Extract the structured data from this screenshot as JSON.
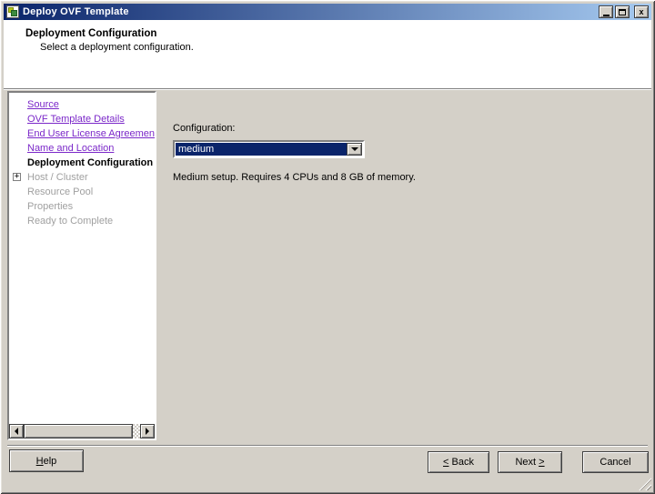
{
  "window": {
    "title": "Deploy OVF Template",
    "controls": {
      "close_glyph": "x"
    }
  },
  "header": {
    "title": "Deployment Configuration",
    "subtitle": "Select a deployment configuration."
  },
  "sidebar": {
    "items": [
      {
        "label": "Source",
        "state": "done"
      },
      {
        "label": "OVF Template Details",
        "state": "done"
      },
      {
        "label": "End User License Agreement",
        "state": "done"
      },
      {
        "label": "Name and Location",
        "state": "done"
      },
      {
        "label": "Deployment Configuration",
        "state": "current"
      },
      {
        "label": "Host / Cluster",
        "state": "pending",
        "expandable": true
      },
      {
        "label": "Resource Pool",
        "state": "pending"
      },
      {
        "label": "Properties",
        "state": "pending"
      },
      {
        "label": "Ready to Complete",
        "state": "pending"
      }
    ]
  },
  "main": {
    "config_label": "Configuration:",
    "config_value": "medium",
    "description": "Medium setup. Requires 4 CPUs and 8 GB of memory."
  },
  "buttons": {
    "help": {
      "mnemonic": "H",
      "label": "elp"
    },
    "back": {
      "mnemonic": "<",
      "label": " Back"
    },
    "next": {
      "label": "Next ",
      "mnemonic": ">"
    },
    "cancel": {
      "label": "Cancel"
    }
  },
  "icons": {
    "app": "ovf-package-icon",
    "expand": "+",
    "minimize": "minimize-icon",
    "maximize": "maximize-icon",
    "close": "close-icon",
    "dropdown": "chevron-down-icon",
    "scroll_left": "arrow-left-icon",
    "scroll_right": "arrow-right-icon",
    "resize": "resize-grip-icon"
  },
  "colors": {
    "titlebar_start": "#0A246A",
    "titlebar_end": "#A6CAF0",
    "window_gray": "#D4D0C8",
    "link_purple": "#7B28C9",
    "disabled_gray": "#A0A0A0",
    "selection_navy": "#0A246A"
  }
}
